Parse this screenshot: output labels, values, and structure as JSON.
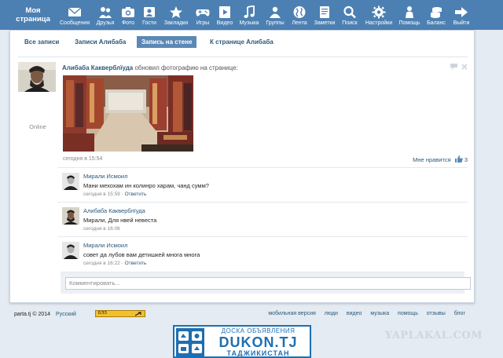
{
  "topbar": {
    "brand": "Моя страница",
    "items": [
      {
        "label": "Сообщения",
        "icon": "envelope-icon"
      },
      {
        "label": "Друзья",
        "icon": "friends-icon"
      },
      {
        "label": "Фото",
        "icon": "camera-icon"
      },
      {
        "label": "Гости",
        "icon": "guests-icon"
      },
      {
        "label": "Закладки",
        "icon": "star-icon"
      },
      {
        "label": "Игры",
        "icon": "gamepad-icon"
      },
      {
        "label": "Видео",
        "icon": "play-icon"
      },
      {
        "label": "Музыка",
        "icon": "music-note-icon"
      },
      {
        "label": "Группы",
        "icon": "groups-icon"
      },
      {
        "label": "Лента",
        "icon": "globe-icon"
      },
      {
        "label": "Заметки",
        "icon": "notes-icon"
      },
      {
        "label": "Поиск",
        "icon": "search-icon"
      },
      {
        "label": "Настройки",
        "icon": "gear-icon"
      },
      {
        "label": "Помощь",
        "icon": "help-person-icon"
      },
      {
        "label": "Баланс",
        "icon": "coins-icon"
      },
      {
        "label": "Выйти",
        "icon": "exit-arrow-icon"
      }
    ]
  },
  "tabs": [
    {
      "label": "Все записи",
      "active": false
    },
    {
      "label": "Записи Алибаба",
      "active": false
    },
    {
      "label": "Запись на стене",
      "active": true
    },
    {
      "label": "К странице Алибаба",
      "active": false
    }
  ],
  "post": {
    "status": "Online",
    "author": "Алибаба Какверблїуда",
    "action": "обновил фотографию на странице:",
    "time": "сегодня в 15:54",
    "likes_label": "Мне нравится",
    "likes_count": "3"
  },
  "comments": [
    {
      "name": "Мирали Исмоил",
      "text": "Мани мехохам ин колинро харам, чанд сумм?",
      "time": "сегодня в 15:59",
      "reply": "Ответить"
    },
    {
      "name": "Алибаба Какверблїуда",
      "text": "Мирали, Для нвей невеста",
      "time": "сегодня в 16:06",
      "reply": ""
    },
    {
      "name": "Мирали Исмоил",
      "text": "совет да лубов вам детишкей многа многа",
      "time": "сегодня в 16:22",
      "reply": "Ответить"
    }
  ],
  "reply": {
    "placeholder": "Комментировать..."
  },
  "footer": {
    "copyright": "parta.tj © 2014",
    "language": "Русский",
    "ad_small_text": "БЭЗ",
    "links": [
      "мобильная версия",
      "люди",
      "видео",
      "музыка",
      "помощь",
      "отзывы",
      "блог"
    ]
  },
  "ad_banner": {
    "line1": "ДОСКА ОБЪЯВЛЕНИЯ",
    "line2": "DUKON.TJ",
    "line3": "ТАДЖИКИСТАН"
  },
  "watermark": "YAPLAKAL.COM",
  "colors": {
    "topbar": "#4d80b2",
    "link": "#2b587a",
    "active_tab": "#5b88b4",
    "background": "#e4ebf2"
  }
}
